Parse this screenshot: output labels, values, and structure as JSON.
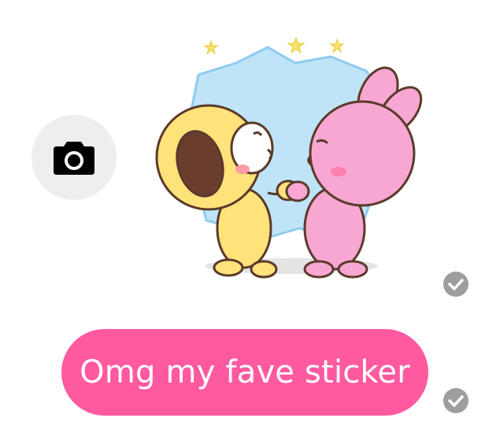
{
  "composer": {
    "camera_icon": "camera-icon"
  },
  "messages": [
    {
      "type": "sticker",
      "sticker_name": "sticker-chimmy-cooky-kiss",
      "status_icon": "read-check-icon"
    },
    {
      "type": "text",
      "text": "Omg my fave sticker",
      "bubble_color": "#ff5aa0",
      "status_icon": "read-check-icon"
    }
  ]
}
